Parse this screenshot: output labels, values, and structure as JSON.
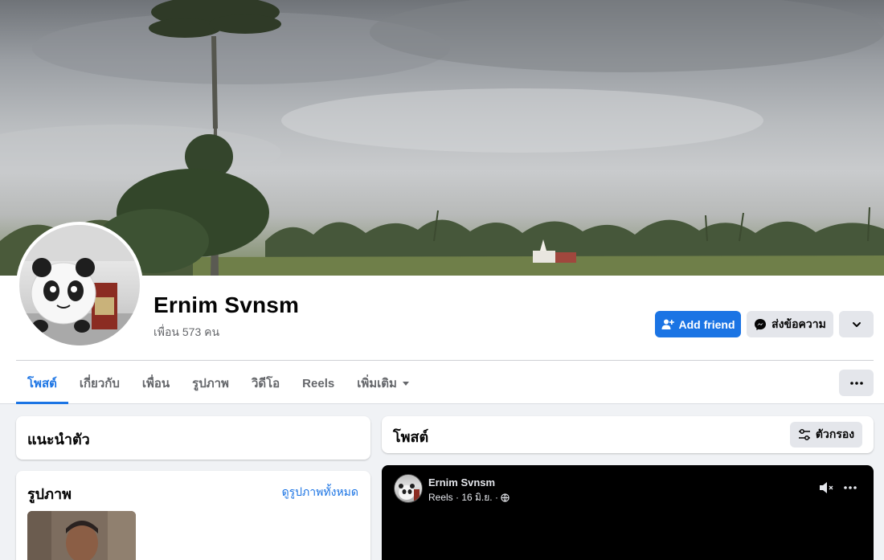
{
  "profile": {
    "name": "Ernim Svnsm",
    "friends_text": "เพื่อน 573 คน"
  },
  "actions": {
    "add_friend": "Add friend",
    "message": "ส่งข้อความ"
  },
  "tabs": [
    {
      "label": "โพสต์",
      "active": true
    },
    {
      "label": "เกี่ยวกับ",
      "active": false
    },
    {
      "label": "เพื่อน",
      "active": false
    },
    {
      "label": "รูปภาพ",
      "active": false
    },
    {
      "label": "วิดีโอ",
      "active": false
    },
    {
      "label": "Reels",
      "active": false
    },
    {
      "label": "เพิ่มเติม",
      "active": false
    }
  ],
  "intro": {
    "title": "แนะนำตัว"
  },
  "photos": {
    "title": "รูปภาพ",
    "see_all": "ดูรูปภาพทั้งหมด"
  },
  "posts": {
    "title": "โพสต์",
    "filter_label": "ตัวกรอง"
  },
  "reel_post": {
    "author": "Ernim Svnsm",
    "meta": "Reels · 16 มิ.ย. ·"
  },
  "colors": {
    "accent": "#1b74e4",
    "background": "#f0f2f5",
    "secondary_button": "#e4e6eb"
  },
  "icons": [
    "add-person-icon",
    "messenger-icon",
    "chevron-down-icon",
    "more-dots-icon",
    "filter-sliders-icon",
    "mute-icon",
    "globe-icon",
    "caret-down-icon"
  ]
}
